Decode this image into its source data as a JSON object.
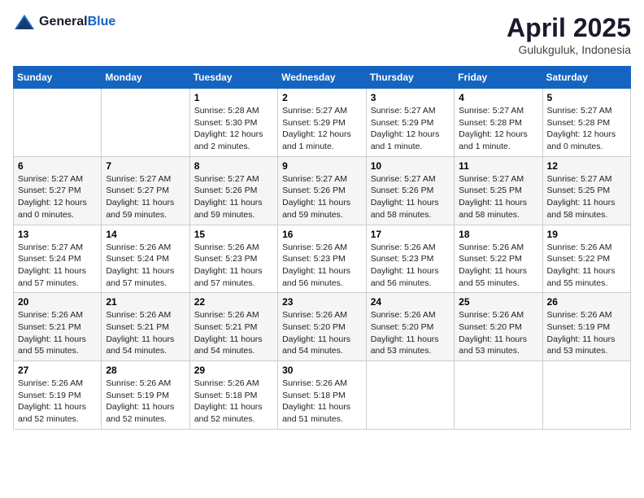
{
  "header": {
    "logo_general": "General",
    "logo_blue": "Blue",
    "month_year": "April 2025",
    "location": "Gulukguluk, Indonesia"
  },
  "columns": [
    "Sunday",
    "Monday",
    "Tuesday",
    "Wednesday",
    "Thursday",
    "Friday",
    "Saturday"
  ],
  "weeks": [
    [
      {
        "day": "",
        "info": ""
      },
      {
        "day": "",
        "info": ""
      },
      {
        "day": "1",
        "info": "Sunrise: 5:28 AM\nSunset: 5:30 PM\nDaylight: 12 hours and 2 minutes."
      },
      {
        "day": "2",
        "info": "Sunrise: 5:27 AM\nSunset: 5:29 PM\nDaylight: 12 hours and 1 minute."
      },
      {
        "day": "3",
        "info": "Sunrise: 5:27 AM\nSunset: 5:29 PM\nDaylight: 12 hours and 1 minute."
      },
      {
        "day": "4",
        "info": "Sunrise: 5:27 AM\nSunset: 5:28 PM\nDaylight: 12 hours and 1 minute."
      },
      {
        "day": "5",
        "info": "Sunrise: 5:27 AM\nSunset: 5:28 PM\nDaylight: 12 hours and 0 minutes."
      }
    ],
    [
      {
        "day": "6",
        "info": "Sunrise: 5:27 AM\nSunset: 5:27 PM\nDaylight: 12 hours and 0 minutes."
      },
      {
        "day": "7",
        "info": "Sunrise: 5:27 AM\nSunset: 5:27 PM\nDaylight: 11 hours and 59 minutes."
      },
      {
        "day": "8",
        "info": "Sunrise: 5:27 AM\nSunset: 5:26 PM\nDaylight: 11 hours and 59 minutes."
      },
      {
        "day": "9",
        "info": "Sunrise: 5:27 AM\nSunset: 5:26 PM\nDaylight: 11 hours and 59 minutes."
      },
      {
        "day": "10",
        "info": "Sunrise: 5:27 AM\nSunset: 5:26 PM\nDaylight: 11 hours and 58 minutes."
      },
      {
        "day": "11",
        "info": "Sunrise: 5:27 AM\nSunset: 5:25 PM\nDaylight: 11 hours and 58 minutes."
      },
      {
        "day": "12",
        "info": "Sunrise: 5:27 AM\nSunset: 5:25 PM\nDaylight: 11 hours and 58 minutes."
      }
    ],
    [
      {
        "day": "13",
        "info": "Sunrise: 5:27 AM\nSunset: 5:24 PM\nDaylight: 11 hours and 57 minutes."
      },
      {
        "day": "14",
        "info": "Sunrise: 5:26 AM\nSunset: 5:24 PM\nDaylight: 11 hours and 57 minutes."
      },
      {
        "day": "15",
        "info": "Sunrise: 5:26 AM\nSunset: 5:23 PM\nDaylight: 11 hours and 57 minutes."
      },
      {
        "day": "16",
        "info": "Sunrise: 5:26 AM\nSunset: 5:23 PM\nDaylight: 11 hours and 56 minutes."
      },
      {
        "day": "17",
        "info": "Sunrise: 5:26 AM\nSunset: 5:23 PM\nDaylight: 11 hours and 56 minutes."
      },
      {
        "day": "18",
        "info": "Sunrise: 5:26 AM\nSunset: 5:22 PM\nDaylight: 11 hours and 55 minutes."
      },
      {
        "day": "19",
        "info": "Sunrise: 5:26 AM\nSunset: 5:22 PM\nDaylight: 11 hours and 55 minutes."
      }
    ],
    [
      {
        "day": "20",
        "info": "Sunrise: 5:26 AM\nSunset: 5:21 PM\nDaylight: 11 hours and 55 minutes."
      },
      {
        "day": "21",
        "info": "Sunrise: 5:26 AM\nSunset: 5:21 PM\nDaylight: 11 hours and 54 minutes."
      },
      {
        "day": "22",
        "info": "Sunrise: 5:26 AM\nSunset: 5:21 PM\nDaylight: 11 hours and 54 minutes."
      },
      {
        "day": "23",
        "info": "Sunrise: 5:26 AM\nSunset: 5:20 PM\nDaylight: 11 hours and 54 minutes."
      },
      {
        "day": "24",
        "info": "Sunrise: 5:26 AM\nSunset: 5:20 PM\nDaylight: 11 hours and 53 minutes."
      },
      {
        "day": "25",
        "info": "Sunrise: 5:26 AM\nSunset: 5:20 PM\nDaylight: 11 hours and 53 minutes."
      },
      {
        "day": "26",
        "info": "Sunrise: 5:26 AM\nSunset: 5:19 PM\nDaylight: 11 hours and 53 minutes."
      }
    ],
    [
      {
        "day": "27",
        "info": "Sunrise: 5:26 AM\nSunset: 5:19 PM\nDaylight: 11 hours and 52 minutes."
      },
      {
        "day": "28",
        "info": "Sunrise: 5:26 AM\nSunset: 5:19 PM\nDaylight: 11 hours and 52 minutes."
      },
      {
        "day": "29",
        "info": "Sunrise: 5:26 AM\nSunset: 5:18 PM\nDaylight: 11 hours and 52 minutes."
      },
      {
        "day": "30",
        "info": "Sunrise: 5:26 AM\nSunset: 5:18 PM\nDaylight: 11 hours and 51 minutes."
      },
      {
        "day": "",
        "info": ""
      },
      {
        "day": "",
        "info": ""
      },
      {
        "day": "",
        "info": ""
      }
    ]
  ]
}
